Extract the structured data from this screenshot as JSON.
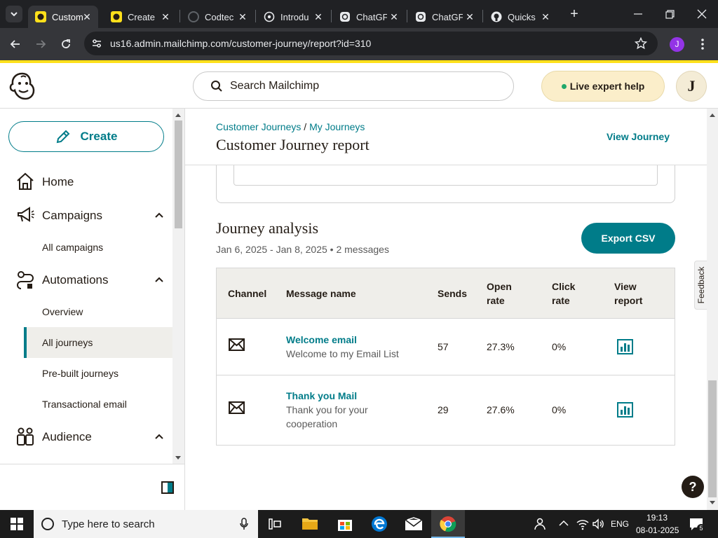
{
  "browser": {
    "tabs": [
      {
        "title": "Custom",
        "active": true
      },
      {
        "title": "Create",
        "active": false
      },
      {
        "title": "Codtec",
        "active": false
      },
      {
        "title": "Introdu",
        "active": false
      },
      {
        "title": "ChatGF",
        "active": false
      },
      {
        "title": "ChatGF",
        "active": false
      },
      {
        "title": "Quicks",
        "active": false
      }
    ],
    "url": "us16.admin.mailchimp.com/customer-journey/report?id=310",
    "profile_initial": "J"
  },
  "header": {
    "search_placeholder": "Search Mailchimp",
    "expert_help": "Live expert help",
    "avatar_initial": "J"
  },
  "sidebar": {
    "create_label": "Create",
    "home": "Home",
    "campaigns": "Campaigns",
    "all_campaigns": "All campaigns",
    "automations": "Automations",
    "overview": "Overview",
    "all_journeys": "All journeys",
    "prebuilt_journeys": "Pre-built journeys",
    "transactional_email": "Transactional email",
    "audience": "Audience"
  },
  "page": {
    "breadcrumb_1": "Customer Journeys",
    "breadcrumb_sep": "/",
    "breadcrumb_2": "My Journeys",
    "title": "Customer Journey report",
    "view_journey": "View Journey",
    "feedback": "Feedback",
    "help": "?"
  },
  "analysis": {
    "title": "Journey analysis",
    "subtitle": "Jan 6, 2025 - Jan 8, 2025 • 2 messages",
    "export_label": "Export CSV",
    "columns": {
      "channel": "Channel",
      "message_name": "Message name",
      "sends": "Sends",
      "open_rate_1": "Open",
      "open_rate_2": "rate",
      "click_rate_1": "Click",
      "click_rate_2": "rate",
      "view_report_1": "View",
      "view_report_2": "report"
    },
    "rows": [
      {
        "name": "Welcome email",
        "subject": "Welcome to my Email List",
        "sends": "57",
        "open_rate": "27.3%",
        "click_rate": "0%"
      },
      {
        "name": "Thank you Mail",
        "subject": "Thank you for your cooperation",
        "sends": "29",
        "open_rate": "27.6%",
        "click_rate": "0%"
      }
    ]
  },
  "taskbar": {
    "search_placeholder": "Type here to search",
    "language": "ENG",
    "time": "19:13",
    "date": "08-01-2025",
    "notifications": "5"
  },
  "colors": {
    "brand_teal": "#007c89",
    "accent_yellow": "#ffe01b"
  }
}
